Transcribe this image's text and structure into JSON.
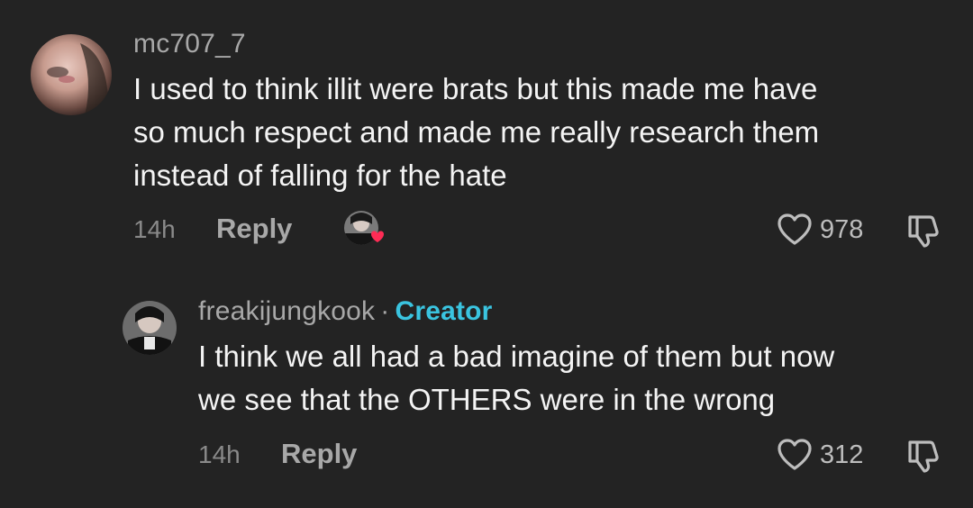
{
  "comments": [
    {
      "username": "mc707_7",
      "text_lines": [
        "I used to think illit were brats but this made me have",
        "so much respect and made me really research them",
        "instead of falling for the hate"
      ],
      "time": "14h",
      "reply_label": "Reply",
      "like_count": "978",
      "creator_liked": true
    }
  ],
  "reply": {
    "username": "freakijungkook",
    "separator": "·",
    "badge": "Creator",
    "text_lines": [
      "I think we all had a bad imagine of them but now",
      "we see that the OTHERS were in the wrong"
    ],
    "time": "14h",
    "reply_label": "Reply",
    "like_count": "312"
  },
  "colors": {
    "background": "#232323",
    "creator_badge": "#3ac4e0",
    "heart_red": "#fe2c55",
    "muted_text": "#a8a8a8"
  },
  "icons": {
    "like": "heart-outline-icon",
    "dislike": "thumbs-down-icon",
    "creator_like": "creator-liked-heart-icon"
  }
}
